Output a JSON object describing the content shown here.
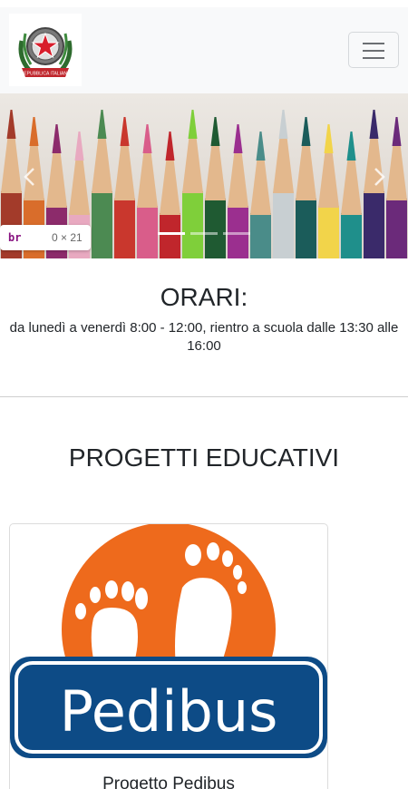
{
  "navbar": {
    "logo_alt": "Repubblica Italiana",
    "logo_text": "REPUBBLICA ITALIANA",
    "toggler_label": "Toggle navigation"
  },
  "carousel": {
    "image_alt": "Colored pencils",
    "prev_label": "Previous",
    "next_label": "Next",
    "indicator_count": 3,
    "active_index": 0
  },
  "devtools_tooltip": {
    "tag": "br",
    "dims": "0 × 21"
  },
  "hours": {
    "title": "ORARI:",
    "text": "da lunedì a venerdì 8:00 - 12:00, rientro a scuola dalle 13:30 alle 16:00"
  },
  "projects": {
    "title": "PROGETTI EDUCATIVI",
    "cards": [
      {
        "logo_text": "Pedibus",
        "title": "Progetto Pedibus",
        "colors": {
          "circle": "#ee6a1c",
          "banner": "#0d4b86"
        }
      }
    ]
  }
}
